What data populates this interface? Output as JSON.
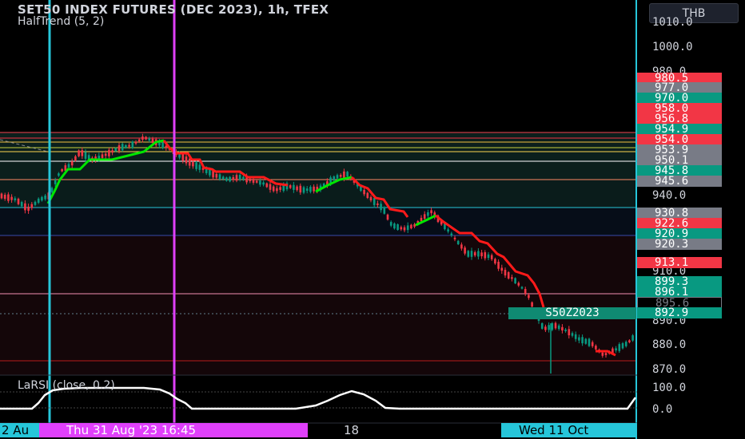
{
  "header": {
    "title": "SET50 INDEX FUTURES (DEC 2023), 1h, TFEX",
    "indicator": "HalfTrend (5, 2)"
  },
  "oscillator": {
    "title": "LaRSI (close, 0.2)",
    "ticks": [
      "100.0",
      "0.0"
    ]
  },
  "currency": "THB",
  "symbol_tag": "S50Z2023",
  "price_ticks": [
    "1010.0",
    "1000.0",
    "980.0",
    "940.0",
    "910.0",
    "890.0",
    "880.0",
    "870.0"
  ],
  "price_tags": [
    {
      "text": "980.5",
      "color": "#f23645"
    },
    {
      "text": "977.0",
      "color": "#787b86"
    },
    {
      "text": "970.0",
      "color": "#089981"
    },
    {
      "text": "958.0",
      "color": "#f23645"
    },
    {
      "text": "956.8",
      "color": "#f23645"
    },
    {
      "text": "954.9",
      "color": "#089981"
    },
    {
      "text": "954.0",
      "color": "#f23645"
    },
    {
      "text": "953.9",
      "color": "#787b86"
    },
    {
      "text": "950.1",
      "color": "#787b86"
    },
    {
      "text": "945.8",
      "color": "#089981"
    },
    {
      "text": "945.6",
      "color": "#787b86"
    },
    {
      "text": "930.8",
      "color": "#787b86"
    },
    {
      "text": "922.6",
      "color": "#f23645"
    },
    {
      "text": "920.9",
      "color": "#089981"
    },
    {
      "text": "920.3",
      "color": "#787b86"
    },
    {
      "text": "913.1",
      "color": "#f23645"
    },
    {
      "text": "899.3",
      "color": "#089981"
    },
    {
      "text": "896.1",
      "color": "#089981"
    },
    {
      "text": "895.6",
      "color": "#000000"
    },
    {
      "text": "892.9",
      "color": "#089981"
    }
  ],
  "time_labels": {
    "left": "2 Au",
    "magenta": "Thu 31 Aug '23   16:45",
    "mid": "18",
    "cyan": "Wed 11 Oct"
  },
  "colors": {
    "up": "#089981",
    "down": "#f23645",
    "halftrend_up": "#00e600",
    "halftrend_down": "#ff1a1a",
    "cyan_line": "#26c6da",
    "magenta_line": "#e040fb"
  }
}
